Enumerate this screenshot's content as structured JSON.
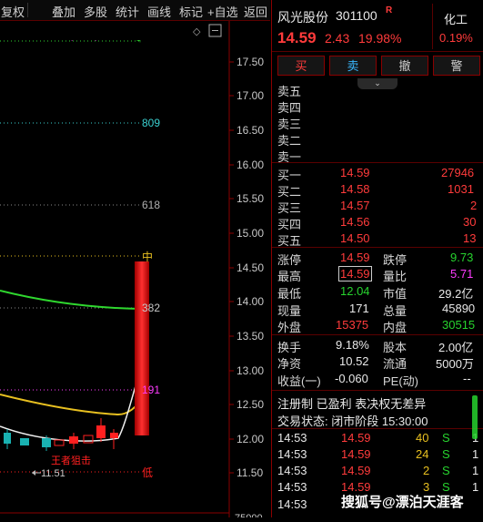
{
  "toolbar": {
    "items": [
      "复权",
      "叠加",
      "多股",
      "统计",
      "画线",
      "标记",
      "+自选",
      "返回"
    ]
  },
  "chart": {
    "price_axis": [
      "17.50",
      "17.00",
      "16.50",
      "16.00",
      "15.50",
      "15.00",
      "14.50",
      "14.00",
      "13.50",
      "13.00",
      "12.50",
      "12.00",
      "11.50"
    ],
    "bottom_partial": "75000",
    "fib_labels": [
      "809",
      "618",
      "中",
      "382",
      "191",
      "低"
    ],
    "signal_text": "王者狙击",
    "low_marker": "11.51",
    "colors": {
      "ma_green": "#2fd82f",
      "ma_yellow": "#e8c020",
      "up": "#ff2020",
      "down": "#19b2b2",
      "fib_cyan": "#3ad0d0",
      "fib_magenta": "#ff3cff"
    }
  },
  "stock": {
    "name": "风光股份",
    "code": "301100",
    "badge": "R",
    "sector": "化工",
    "sector_change": "0.19%",
    "price": "14.59",
    "change": "2.43",
    "change_pct": "19.98%"
  },
  "actions": [
    "买",
    "卖",
    "撤",
    "警"
  ],
  "orderbook": {
    "asks": [
      {
        "label": "卖五",
        "price": "",
        "vol": ""
      },
      {
        "label": "卖四",
        "price": "",
        "vol": ""
      },
      {
        "label": "卖三",
        "price": "",
        "vol": ""
      },
      {
        "label": "卖二",
        "price": "",
        "vol": ""
      },
      {
        "label": "卖一",
        "price": "",
        "vol": ""
      }
    ],
    "bids": [
      {
        "label": "买一",
        "price": "14.59",
        "vol": "27946"
      },
      {
        "label": "买二",
        "price": "14.58",
        "vol": "1031"
      },
      {
        "label": "买三",
        "price": "14.57",
        "vol": "2"
      },
      {
        "label": "买四",
        "price": "14.56",
        "vol": "30"
      },
      {
        "label": "买五",
        "price": "14.50",
        "vol": "13"
      }
    ]
  },
  "stats": {
    "limit_up_label": "涨停",
    "limit_up": "14.59",
    "limit_down_label": "跌停",
    "limit_down": "9.73",
    "high_label": "最高",
    "high": "14.59",
    "vol_ratio_label": "量比",
    "vol_ratio": "5.71",
    "low_label": "最低",
    "low": "12.04",
    "mktcap_label": "市值",
    "mktcap": "29.2亿",
    "cur_vol_label": "现量",
    "cur_vol": "171",
    "total_vol_label": "总量",
    "total_vol": "45890",
    "outer_label": "外盘",
    "outer": "15375",
    "inner_label": "内盘",
    "inner": "30515",
    "turnover_label": "换手",
    "turnover": "9.18%",
    "equity_label": "股本",
    "equity": "2.00亿",
    "nav_label": "净资",
    "nav": "10.52",
    "float_label": "流通",
    "float": "5000万",
    "eps_label": "收益(一)",
    "eps": "-0.060",
    "pe_label": "PE(动)",
    "pe": "--"
  },
  "info": {
    "line1": "注册制 已盈利 表决权无差异",
    "status": "交易状态: 闭市阶段 15:30:00"
  },
  "ticks": [
    {
      "time": "14:53",
      "price": "14.59",
      "vol": "40",
      "side": "S",
      "n": "1"
    },
    {
      "time": "14:53",
      "price": "14.59",
      "vol": "24",
      "side": "S",
      "n": "1"
    },
    {
      "time": "14:53",
      "price": "14.59",
      "vol": "2",
      "side": "S",
      "n": "1"
    },
    {
      "time": "14:53",
      "price": "14.59",
      "vol": "3",
      "side": "S",
      "n": "1"
    },
    {
      "time": "14:53",
      "price": "",
      "vol": "",
      "side": "",
      "n": ""
    }
  ],
  "watermark": "搜狐号@漂泊天涯客"
}
